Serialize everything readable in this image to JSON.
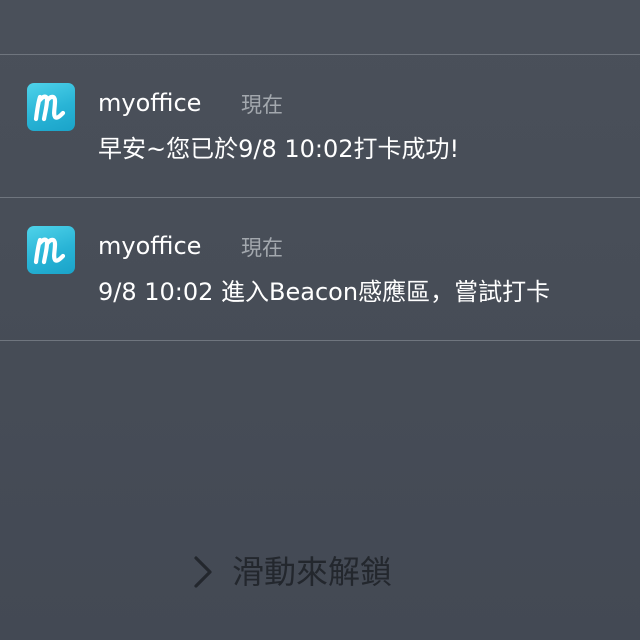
{
  "notifications": [
    {
      "app_name": "myoffice",
      "timestamp": "現在",
      "message": "早安~您已於9/8 10:02打卡成功!",
      "icon": "myoffice-m-icon"
    },
    {
      "app_name": "myoffice",
      "timestamp": "現在",
      "message": "9/8 10:02 進入Beacon感應區，嘗試打卡",
      "icon": "myoffice-m-icon"
    }
  ],
  "unlock": {
    "label": "滑動來解鎖",
    "icon": "chevron-right-icon"
  },
  "colors": {
    "background": "#474d57",
    "icon_accent": "#29b4d6",
    "timestamp": "#a3a8ae",
    "unlock_text": "#23272d"
  }
}
